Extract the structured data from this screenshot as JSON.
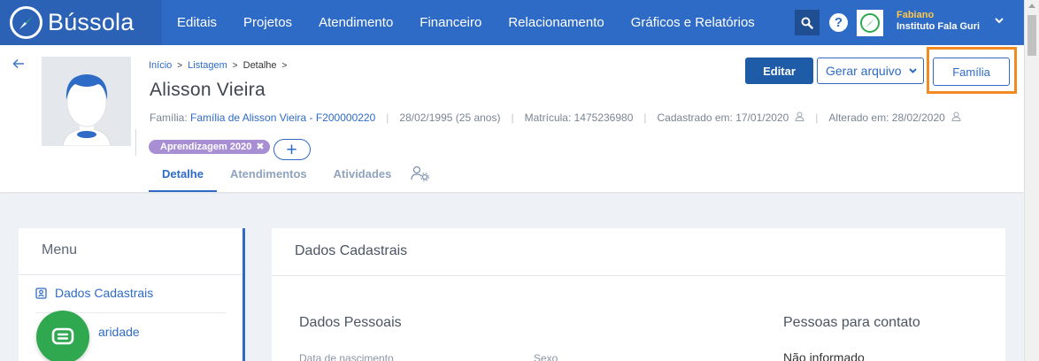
{
  "navbar": {
    "brand": "Bússola",
    "links": [
      "Editais",
      "Projetos",
      "Atendimento",
      "Financeiro",
      "Relacionamento",
      "Gráficos e Relatórios"
    ],
    "help_glyph": "?",
    "user_name": "Fabiano",
    "user_org": "Instituto Fala Guri",
    "icons": {
      "search": "search-icon",
      "help": "help-icon",
      "org_logo": "org-logo",
      "caret": "chevron-down-icon"
    },
    "colors": {
      "bar": "#2e6bc6",
      "brand": "#2b62b5",
      "user_name": "#ffc94a"
    }
  },
  "breadcrumb": {
    "items": [
      "Início",
      "Listagem",
      "Detalhe"
    ],
    "separator": ">"
  },
  "person": {
    "name": "Alisson Vieira",
    "family_label": "Família:",
    "family_link": "Família de Alisson Vieira - F200000220",
    "birth": "28/02/1995 (25 anos)",
    "registration": "Matrícula: 1475236980",
    "created": "Cadastrado em: 17/01/2020",
    "updated": "Alterado em: 28/02/2020",
    "meta_separator": "|"
  },
  "tags": [
    {
      "label": "Aprendizagem 2020",
      "remove": "✖"
    }
  ],
  "add_tag_label": "+",
  "actions": {
    "edit": "Editar",
    "generate": "Gerar arquivo",
    "family": "Família",
    "highlight_color": "#f28a22"
  },
  "tabs": [
    "Detalhe",
    "Atendimentos",
    "Atividades"
  ],
  "menu": {
    "title": "Menu",
    "items": [
      "Dados Cadastrais",
      "aridade"
    ]
  },
  "main": {
    "title": "Dados Cadastrais",
    "section_personal": "Dados Pessoais",
    "section_contacts": "Pessoas para contato",
    "label_birth": "Data de nascimento",
    "label_sex": "Sexo",
    "contacts_value": "Não informado"
  }
}
